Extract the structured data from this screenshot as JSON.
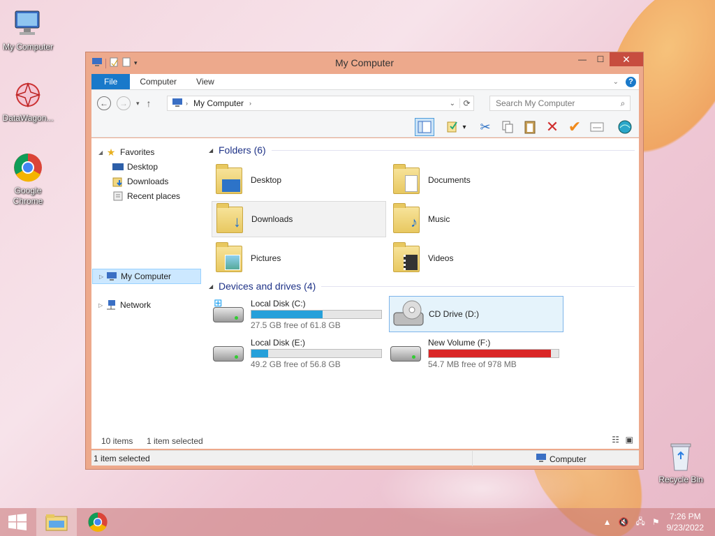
{
  "desktop": {
    "icons": [
      {
        "label": "My Computer"
      },
      {
        "label": "DataWagon..."
      },
      {
        "label": "Google Chrome"
      },
      {
        "label": "Recycle Bin"
      }
    ]
  },
  "window": {
    "title": "My Computer",
    "ribbon_tabs": [
      "File",
      "Computer",
      "View"
    ],
    "help_label": "?",
    "address_path": "My Computer",
    "search_placeholder": "Search My Computer"
  },
  "nav_pane": {
    "favorites_label": "Favorites",
    "favorites": [
      "Desktop",
      "Downloads",
      "Recent places"
    ],
    "computer_label": "My Computer",
    "network_label": "Network"
  },
  "folders": {
    "header": "Folders (6)",
    "items": [
      "Desktop",
      "Documents",
      "Downloads",
      "Music",
      "Pictures",
      "Videos"
    ]
  },
  "drives": {
    "header": "Devices and drives (4)",
    "items": [
      {
        "name": "Local Disk (C:)",
        "free": "27.5 GB free of 61.8 GB",
        "used_fraction": 0.55
      },
      {
        "name": "CD Drive (D:)"
      },
      {
        "name": "Local Disk (E:)",
        "free": "49.2 GB free of 56.8 GB",
        "used_fraction": 0.13
      },
      {
        "name": "New Volume (F:)",
        "free": "54.7 MB free of 978 MB",
        "used_fraction": 0.94
      }
    ]
  },
  "status": {
    "items_count": "10 items",
    "selection": "1 item selected",
    "bottom_left": "1 item selected",
    "bottom_right": "Computer"
  },
  "taskbar": {
    "time": "7:26 PM",
    "date": "9/23/2022"
  },
  "colors": {
    "accent": "#1979ca",
    "window_frame": "#eda98c",
    "usage_bar": "#26a0da",
    "usage_bar_full": "#da2626"
  }
}
